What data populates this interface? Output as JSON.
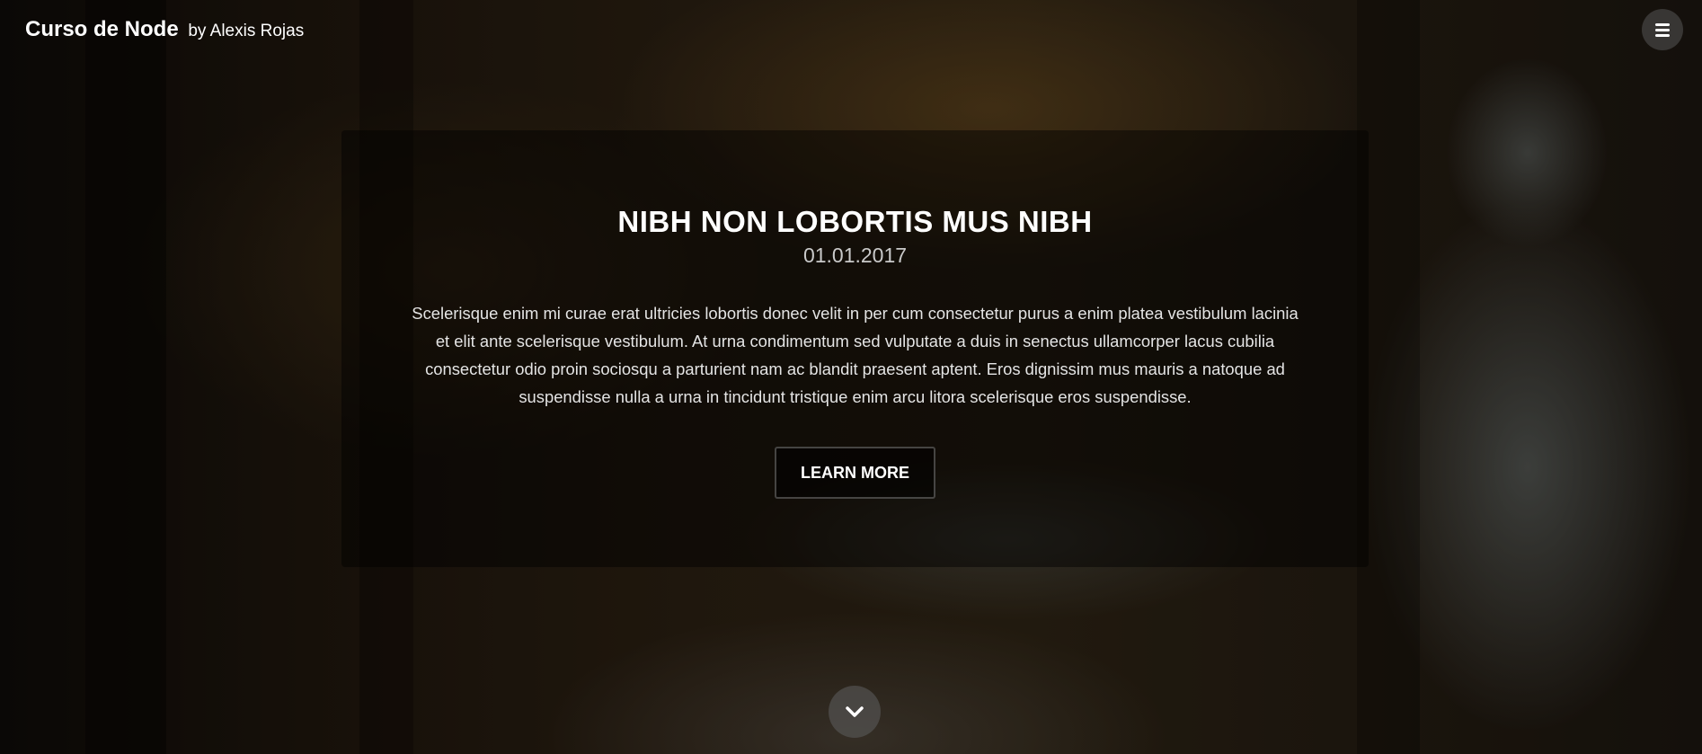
{
  "header": {
    "brand_name": "Curso de Node",
    "brand_by": "by Alexis Rojas",
    "menu_icon": "hamburger-menu-icon"
  },
  "post": {
    "title": "NIBH NON LOBORTIS MUS NIBH",
    "date": "01.01.2017",
    "body": "Scelerisque enim mi curae erat ultricies lobortis donec velit in per cum consectetur purus a enim platea vestibulum lacinia et elit ante scelerisque vestibulum. At urna condimentum sed vulputate a duis in senectus ullamcorper lacus cubilia consectetur odio proin sociosqu a parturient nam ac blandit praesent aptent. Eros dignissim mus mauris a natoque ad suspendisse nulla a urna in tincidunt tristique enim arcu litora scelerisque eros suspendisse.",
    "button_label": "LEARN MORE"
  },
  "scroll": {
    "icon": "chevron-down-icon"
  },
  "colors": {
    "panel_overlay": "#000000",
    "text": "#ffffff",
    "date_text": "#c9c9c9"
  }
}
